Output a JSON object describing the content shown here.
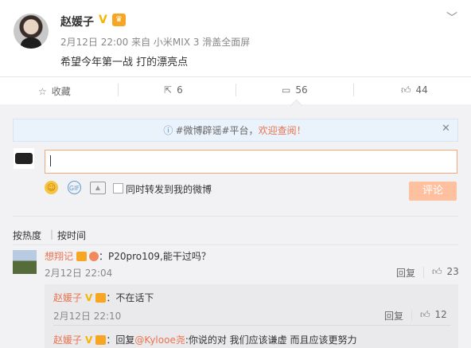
{
  "post": {
    "username": "赵媛子",
    "v_badge": "V",
    "crown_icon": "crown-icon",
    "meta": "2月12日 22:00 来自 小米MIX 3 滑盖全面屏",
    "text": "希望今年第一战 打的漂亮点"
  },
  "actions": {
    "favorite_label": "收藏",
    "repost_count": "6",
    "comment_count": "56",
    "like_count": "44"
  },
  "banner": {
    "prefix": "#微博辟谣#平台，",
    "link": "欢迎查阅！"
  },
  "composer": {
    "checkbox_label": "同时转发到我的微博",
    "submit_label": "评论",
    "gif_label": "GIF"
  },
  "sort": {
    "hot": "按热度",
    "time": "按时间"
  },
  "comments": [
    {
      "name": "想翔记",
      "text": "：P20pro109,能干过吗？",
      "time": "2月12日 22:04",
      "reply_label": "回复",
      "likes": "23"
    }
  ],
  "replies": [
    {
      "name": "赵媛子",
      "text": "：不在话下",
      "time": "2月12日 22:10",
      "reply_label": "回复",
      "likes": "12"
    },
    {
      "name": "赵媛子",
      "prefix": "：回复",
      "mention": "@Kylooe尧",
      "text": ":你说的对 我们应该谦虚 而且应该更努力"
    }
  ],
  "colors": {
    "accent": "#eb7350",
    "badge": "#f7b500",
    "submit_disabled": "#ffc09f"
  }
}
